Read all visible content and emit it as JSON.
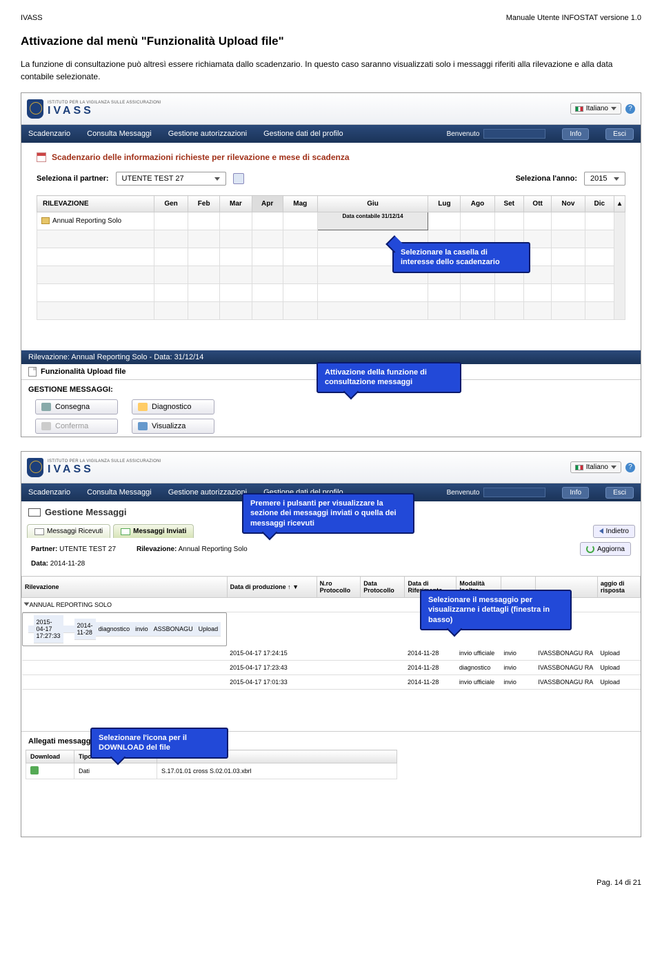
{
  "hdr": {
    "left": "IVASS",
    "right": "Manuale Utente INFOSTAT versione 1.0"
  },
  "title": "Attivazione dal menù \"Funzionalità Upload file\"",
  "para": "La funzione di consultazione può altresì essere richiamata dallo scadenzario. In questo caso saranno visualizzati solo i messaggi riferiti alla rilevazione e alla data contabile selezionate.",
  "app": {
    "lang": "Italiano",
    "nav": [
      "Scadenzario",
      "Consulta Messaggi",
      "Gestione autorizzazioni",
      "Gestione dati del profilo"
    ],
    "benvenuto": "Benvenuto",
    "info": "Info",
    "esci": "Esci",
    "panelTitle": "Scadenzario delle informazioni richieste per rilevazione e mese di scadenza",
    "selPartnerLbl": "Seleziona il partner:",
    "partner": "UTENTE TEST 27",
    "selAnnoLbl": "Seleziona l'anno:",
    "anno": "2015",
    "months": [
      "Gen",
      "Feb",
      "Mar",
      "Apr",
      "Mag",
      "Giu",
      "Lug",
      "Ago",
      "Set",
      "Ott",
      "Nov",
      "Dic"
    ],
    "rilevHdr": "RILEVAZIONE",
    "rilevRow": "Annual Reporting Solo",
    "cellData": "Data contabile 31/12/14",
    "lowerBar": "Rilevazione: Annual Reporting Solo - Data: 31/12/14",
    "funcRow": "Funzionalità Upload file",
    "gest": "GESTIONE MESSAGGI:",
    "btns": {
      "consegna": "Consegna",
      "diagnostico": "Diagnostico",
      "conferma": "Conferma",
      "visualizza": "Visualizza"
    }
  },
  "co": {
    "c1": "Selezionare la casella di interesse dello scadenzario",
    "c2": "Attivazione della funzione di consultazione messaggi",
    "c3": "Premere i pulsanti per visualizzare la sezione dei messaggi inviati o quella dei messaggi ricevuti",
    "c4": "Selezionare il messaggio per visualizzarne i dettagli (finestra in basso)",
    "c5": "Selezionare l'icona per il DOWNLOAD del file"
  },
  "s2": {
    "gestM": "Gestione Messaggi",
    "tabRic": "Messaggi Ricevuti",
    "tabInv": "Messaggi Inviati",
    "indietro": "Indietro",
    "partnerLbl": "Partner:",
    "partner": "UTENTE TEST 27",
    "rilevLbl": "Rilevazione:",
    "rilev": "Annual Reporting Solo",
    "aggiorna": "Aggiorna",
    "dataLbl": "Data:",
    "data": "2014-11-28",
    "cols": [
      "Rilevazione",
      "Data di produzione ↑ ▼",
      "N.ro Protocollo",
      "Data Protocollo",
      "Data di Riferimento",
      "Modalità Inoltro",
      "",
      "",
      "aggio di risposta"
    ],
    "grp": "ANNUAL REPORTING SOLO",
    "rows": [
      {
        "dp": "2015-04-17 17:27:33",
        "dr": "2014-11-28",
        "mi": "diagnostico",
        "st": "invio",
        "u": "ASSBONAGU",
        "t": "Upload"
      },
      {
        "dp": "2015-04-17 17:24:15",
        "dr": "2014-11-28",
        "mi": "invio ufficiale",
        "st": "invio",
        "u": "IVASSBONAGU RA",
        "t": "Upload"
      },
      {
        "dp": "2015-04-17 17:23:43",
        "dr": "2014-11-28",
        "mi": "diagnostico",
        "st": "invio",
        "u": "IVASSBONAGU RA",
        "t": "Upload"
      },
      {
        "dp": "2015-04-17 17:01:33",
        "dr": "2014-11-28",
        "mi": "invio ufficiale",
        "st": "invio",
        "u": "IVASSBONAGU RA",
        "t": "Upload"
      }
    ],
    "att": "Allegati messaggio:",
    "attCols": [
      "Download",
      "Tipo frammento",
      "File"
    ],
    "attRow": {
      "tipo": "Dati",
      "file": "S.17.01.01 cross S.02.01.03.xbrl"
    }
  },
  "footer": "Pag. 14 di 21"
}
